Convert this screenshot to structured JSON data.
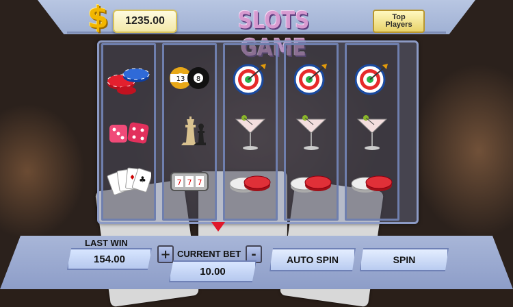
{
  "header": {
    "currency_symbol": "$",
    "balance": "1235.00",
    "title": "SLOTS GAME",
    "top_players_line1": "Top",
    "top_players_line2": "Players"
  },
  "reels": [
    [
      "poker-chips-icon",
      "dice-icon",
      "playing-cards-icon"
    ],
    [
      "billiard-balls-icon",
      "chess-pieces-icon",
      "slot-machine-icon"
    ],
    [
      "dart-target-icon",
      "martini-glass-icon",
      "checkers-icon"
    ],
    [
      "dart-target-icon",
      "martini-glass-icon",
      "checkers-icon"
    ],
    [
      "dart-target-icon",
      "martini-glass-icon",
      "checkers-icon"
    ]
  ],
  "billiard": {
    "ball1": "13",
    "ball2": "8"
  },
  "controls": {
    "last_win_label": "LAST WIN",
    "last_win_value": "154.00",
    "plus": "+",
    "current_bet_label": "CURRENT BET",
    "minus": "-",
    "current_bet_value": "10.00",
    "auto_spin": "AUTO SPIN",
    "spin": "SPIN"
  },
  "colors": {
    "title": "#d79ad0",
    "coin": "#f2b600",
    "panel": "#a8b6d8",
    "pointer": "#e0182a"
  }
}
